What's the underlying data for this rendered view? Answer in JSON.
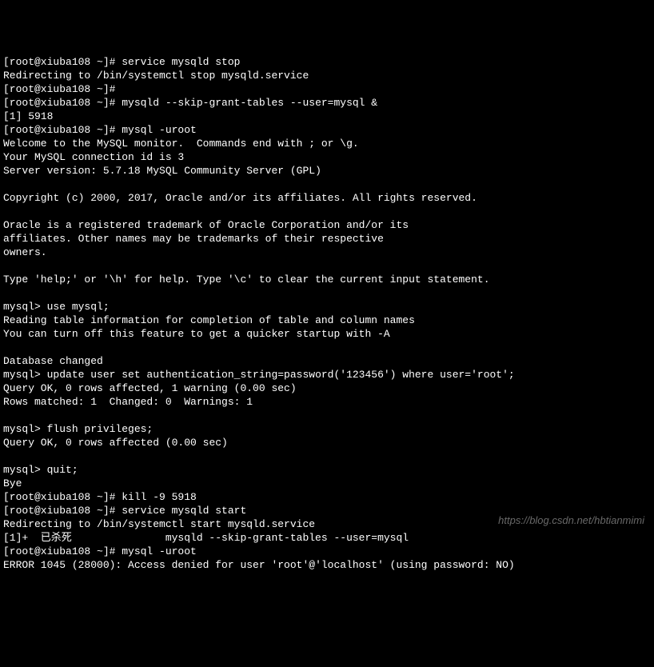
{
  "terminal": {
    "lines": [
      "[root@xiuba108 ~]# service mysqld stop",
      "Redirecting to /bin/systemctl stop mysqld.service",
      "[root@xiuba108 ~]#",
      "[root@xiuba108 ~]# mysqld --skip-grant-tables --user=mysql &",
      "[1] 5918",
      "[root@xiuba108 ~]# mysql -uroot",
      "Welcome to the MySQL monitor.  Commands end with ; or \\g.",
      "Your MySQL connection id is 3",
      "Server version: 5.7.18 MySQL Community Server (GPL)",
      "",
      "Copyright (c) 2000, 2017, Oracle and/or its affiliates. All rights reserved.",
      "",
      "Oracle is a registered trademark of Oracle Corporation and/or its",
      "affiliates. Other names may be trademarks of their respective",
      "owners.",
      "",
      "Type 'help;' or '\\h' for help. Type '\\c' to clear the current input statement.",
      "",
      "mysql> use mysql;",
      "Reading table information for completion of table and column names",
      "You can turn off this feature to get a quicker startup with -A",
      "",
      "Database changed",
      "mysql> update user set authentication_string=password('123456') where user='root';",
      "Query OK, 0 rows affected, 1 warning (0.00 sec)",
      "Rows matched: 1  Changed: 0  Warnings: 1",
      "",
      "mysql> flush privileges;",
      "Query OK, 0 rows affected (0.00 sec)",
      "",
      "mysql> quit;",
      "Bye",
      "[root@xiuba108 ~]# kill -9 5918",
      "[root@xiuba108 ~]# service mysqld start",
      "Redirecting to /bin/systemctl start mysqld.service",
      "[1]+  已杀死               mysqld --skip-grant-tables --user=mysql",
      "[root@xiuba108 ~]# mysql -uroot",
      "ERROR 1045 (28000): Access denied for user 'root'@'localhost' (using password: NO)"
    ]
  },
  "watermark": "https://blog.csdn.net/hbtianmimi"
}
